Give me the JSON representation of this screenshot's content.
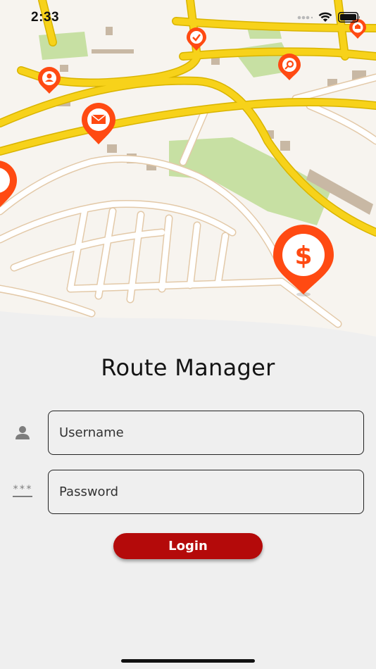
{
  "status_bar": {
    "time": "2:33"
  },
  "app": {
    "title": "Route Manager"
  },
  "form": {
    "username_placeholder": "Username",
    "username_value": "",
    "password_placeholder": "Password",
    "password_value": "",
    "password_icon_text": "***",
    "login_label": "Login"
  },
  "map_pins": [
    {
      "icon": "check-icon"
    },
    {
      "icon": "user-icon"
    },
    {
      "icon": "search-icon"
    },
    {
      "icon": "mail-icon"
    },
    {
      "icon": "home-icon"
    },
    {
      "icon": "dollar-icon",
      "text": "$"
    }
  ],
  "colors": {
    "pin": "#ff4a12",
    "button": "#b40a0a",
    "road_major": "#f7d21a",
    "park": "#c7e0a3",
    "building": "#c8b8a4",
    "map_bg": "#f7f4ef",
    "page_bg": "#efefef"
  }
}
